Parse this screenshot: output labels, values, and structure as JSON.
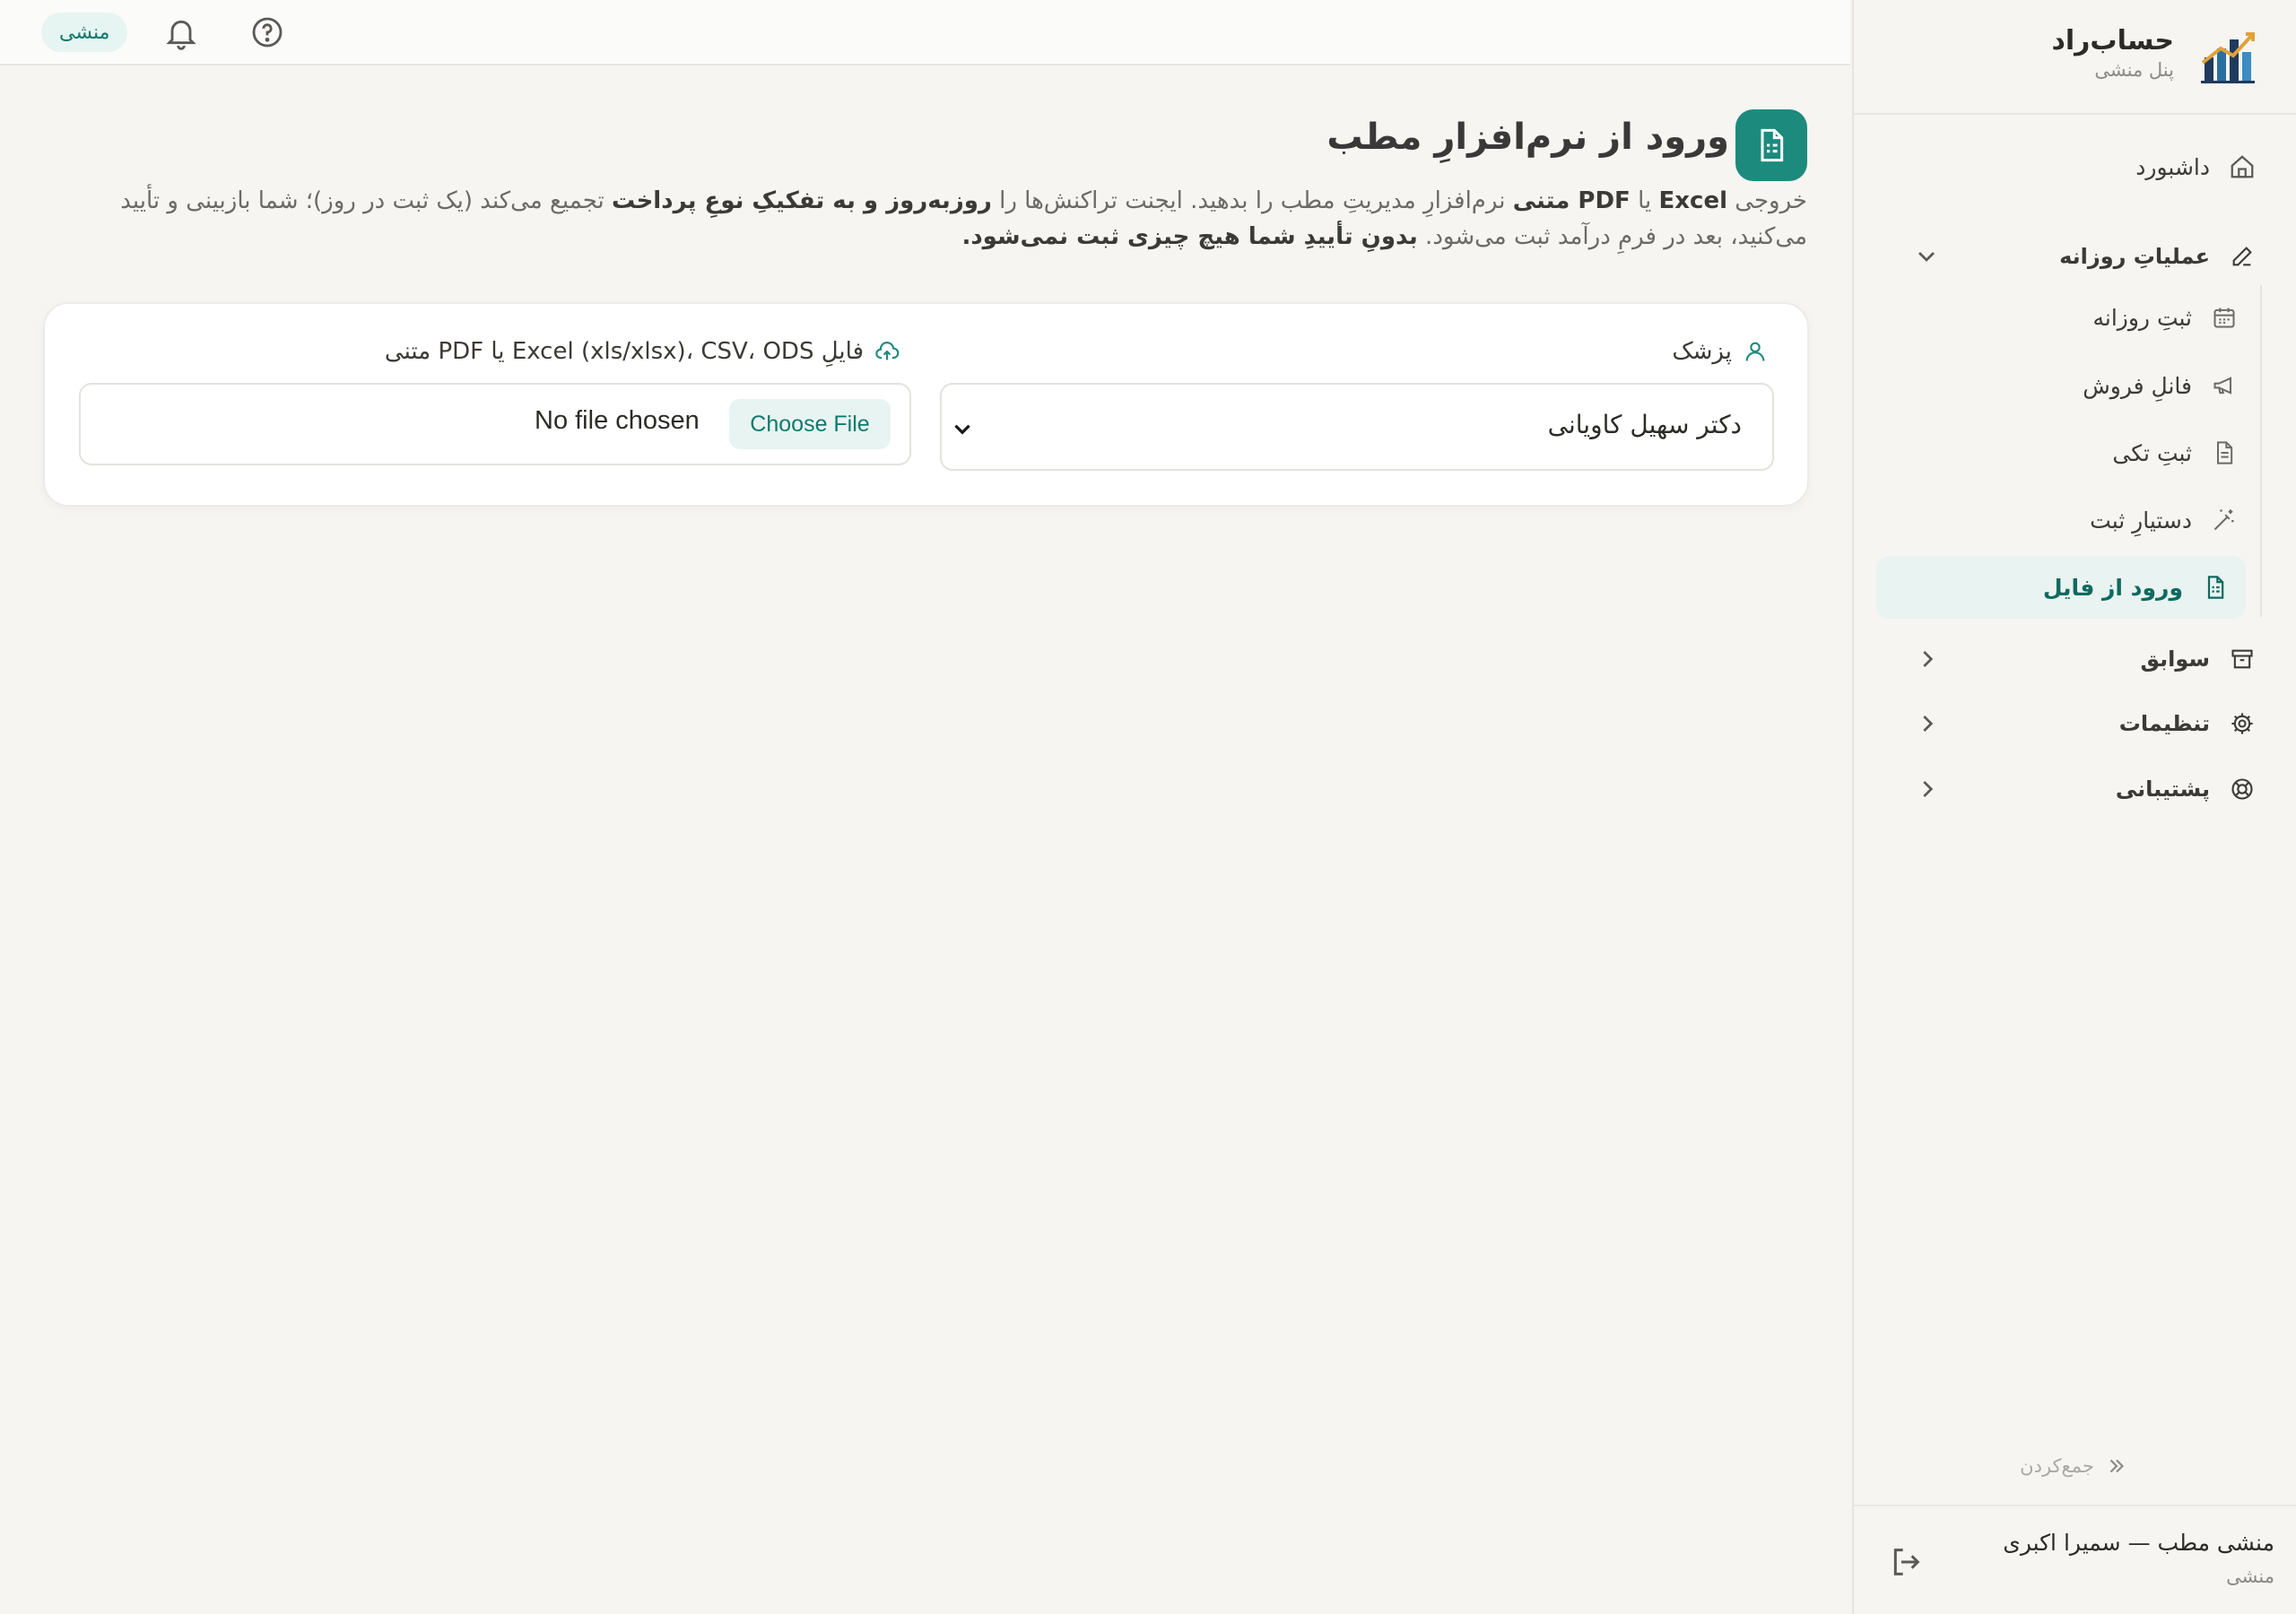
{
  "brand": {
    "title": "حساب‌راد",
    "subtitle": "پنل منشی"
  },
  "sidebar": {
    "items": [
      {
        "label": "داشبورد",
        "icon": "home-icon"
      },
      {
        "label": "عملیاتِ روزانه",
        "icon": "pencil-icon"
      },
      {
        "label": "ثبتِ روزانه",
        "icon": "calendar-icon"
      },
      {
        "label": "فانلِ فروش",
        "icon": "megaphone-icon"
      },
      {
        "label": "ثبتِ تکی",
        "icon": "document-icon"
      },
      {
        "label": "دستیارِ ثبت",
        "icon": "magic-wand-icon"
      },
      {
        "label": "ورود از فایل",
        "icon": "file-spreadsheet-icon"
      },
      {
        "label": "سوابق",
        "icon": "archive-icon"
      },
      {
        "label": "تنظیمات",
        "icon": "gear-icon"
      },
      {
        "label": "پشتیبانی",
        "icon": "lifebuoy-icon"
      }
    ],
    "collapse_label": "جمع‌کردن",
    "user": {
      "name": "منشی مطب — سمیرا اکبری",
      "role": "منشی"
    }
  },
  "topbar": {
    "role_chip": "منشی"
  },
  "main": {
    "title": "ورود از نرم‌افزارِ مطب",
    "desc": {
      "p1": "خروجی ",
      "b1": "Excel",
      "p2": " یا ",
      "b2": "PDF متنی",
      "p3": " نرم‌افزارِ مدیریتِ مطب را بدهید. ایجنت تراکنش‌ها را ",
      "b3": "روزبه‌روز و به تفکیکِ نوعِ پرداخت",
      "p4": " تجمیع می‌کند (یک ثبت در روز)؛ شما بازبینی و تأیید می‌کنید، بعد در فرمِ درآمد ثبت می‌شود. ",
      "b4": "بدونِ تأییدِ شما هیچ چیزی ثبت نمی‌شود."
    },
    "doctor_label": "پزشک",
    "doctor_value": "دکتر سهیل کاویانی",
    "file_label": "فایلِ Excel (xls/xlsx)، CSV، ODS یا PDF متنی",
    "choose_file": "Choose File",
    "no_file": "No file chosen"
  },
  "colors": {
    "accent": "#1d8a7e",
    "active_bg": "#e9f3f1",
    "text": "#3b3a37"
  }
}
